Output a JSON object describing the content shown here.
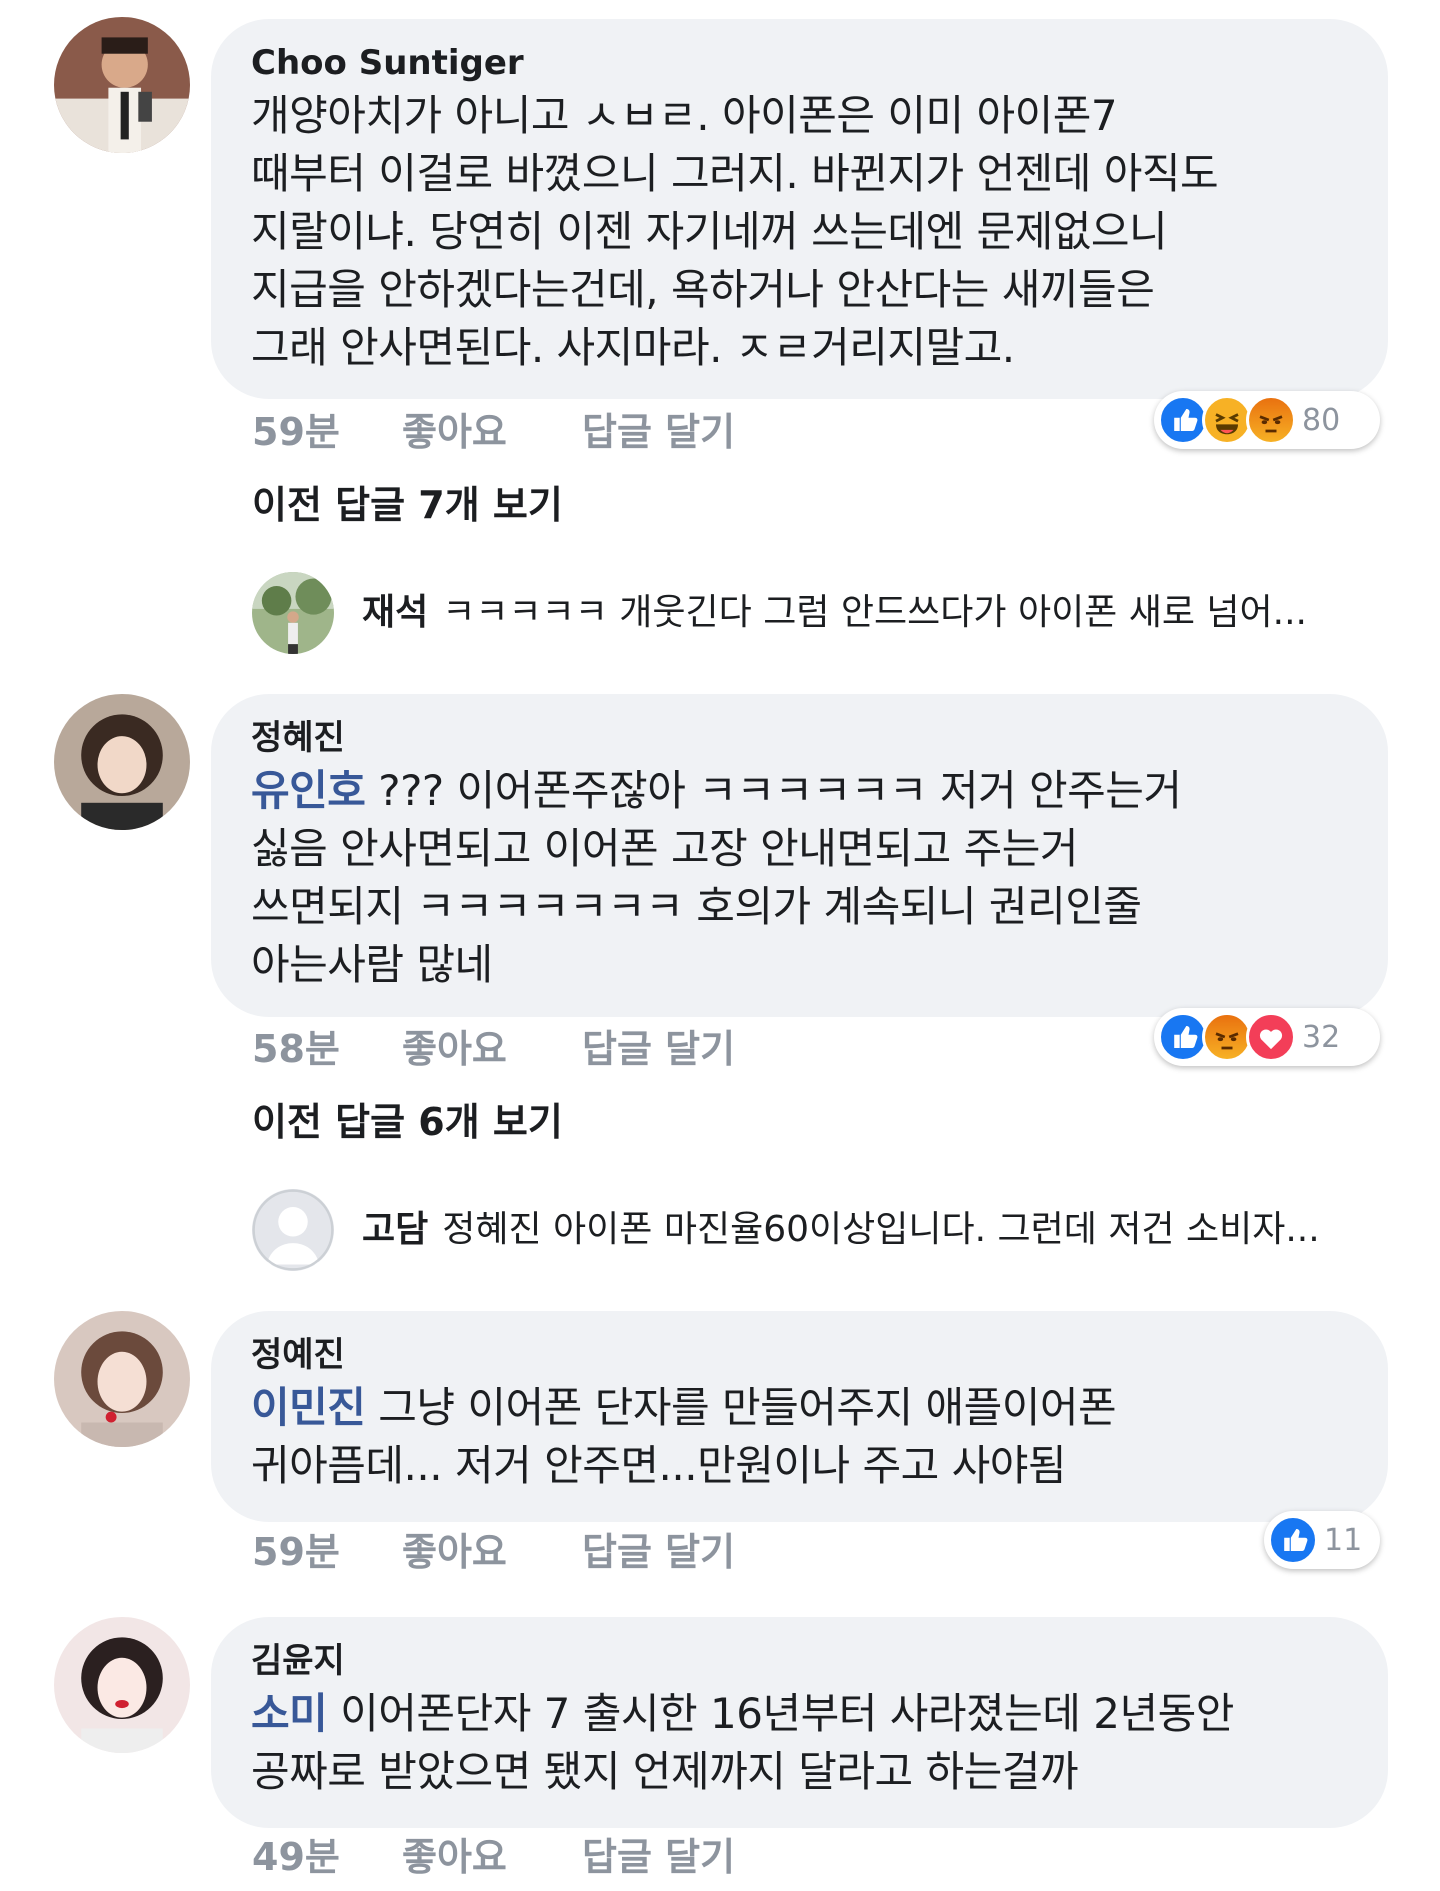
{
  "comments": [
    {
      "author": "Choo Suntiger",
      "lines": [
        "개양아치가 아니고 ㅅㅂㄹ. 아이폰은 이미 아이폰7",
        "때부터 이걸로 바꼈으니 그러지. 바뀐지가 언젠데 아직도",
        "지랄이냐. 당연히 이젠 자기네꺼 쓰는데엔 문제없으니",
        "지급을 안하겠다는건데, 욕하거나 안산다는 새끼들은",
        "그래 안사면된다. 사지마라. ㅈㄹ거리지말고."
      ],
      "time": "59분",
      "like": "좋아요",
      "reply": "답글 달기",
      "reactions": [
        "like-icon",
        "haha-icon",
        "angry-icon"
      ],
      "reaction_count": "80",
      "view_previous": "이전 답글 7개 보기",
      "latest_reply": {
        "author": "재석",
        "text": "ㅋㅋㅋㅋㅋ 개웃긴다 그럼 안드쓰다가 아이폰 새로 넘어..."
      }
    },
    {
      "author": "정혜진",
      "mention": "유인호",
      "lines": [
        " ??? 이어폰주잖아 ㅋㅋㅋㅋㅋㅋ 저거 안주는거",
        "싫음 안사면되고 이어폰 고장 안내면되고 주는거",
        "쓰면되지 ㅋㅋㅋㅋㅋㅋㅋ 호의가 계속되니 권리인줄",
        "아는사람 많네"
      ],
      "time": "58분",
      "like": "좋아요",
      "reply": "답글 달기",
      "reactions": [
        "like-icon",
        "angry-icon",
        "love-icon"
      ],
      "reaction_count": "32",
      "view_previous": "이전 답글 6개 보기",
      "latest_reply": {
        "author": "고담",
        "text": "정혜진 아이폰 마진율60이상입니다. 그런데 저건 소비자..."
      }
    },
    {
      "author": "정예진",
      "mention": "이민진",
      "lines": [
        " 그냥 이어폰 단자를 만들어주지 애플이어폰",
        "귀아픔데... 저거 안주면...만원이나 주고 사야됨"
      ],
      "time": "59분",
      "like": "좋아요",
      "reply": "답글 달기",
      "reactions": [
        "like-icon"
      ],
      "reaction_count": "11"
    },
    {
      "author": "김윤지",
      "mention": "소미",
      "lines": [
        " 이어폰단자 7 출시한 16년부터 사라졌는데 2년동안",
        "공짜로 받았으면 됐지 언제까지 달라고 하는걸까"
      ],
      "time": "49분",
      "like": "좋아요",
      "reply": "답글 달기"
    }
  ],
  "colors": {
    "bubble": "#f0f2f5",
    "mention": "#385898",
    "meta": "#8d949e",
    "like_blue": "#1877f2",
    "haha_yellow": "#f7b125",
    "angry_orange": "#e9710f",
    "love_red": "#f33e58"
  }
}
